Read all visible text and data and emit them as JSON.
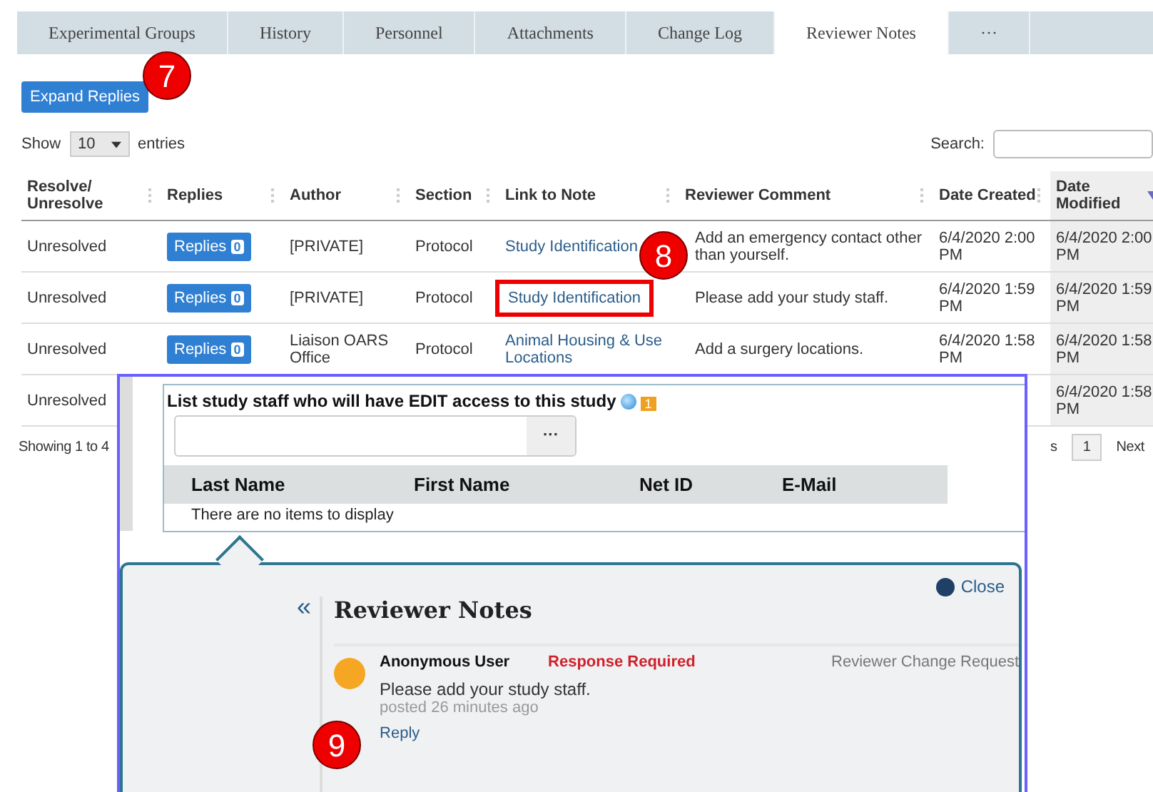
{
  "tabs": [
    {
      "label": "Experimental Groups",
      "selected": false
    },
    {
      "label": "History",
      "selected": false
    },
    {
      "label": "Personnel",
      "selected": false
    },
    {
      "label": "Attachments",
      "selected": false
    },
    {
      "label": "Change Log",
      "selected": false
    },
    {
      "label": "Reviewer Notes",
      "selected": true
    },
    {
      "label": "···",
      "selected": false
    }
  ],
  "expand_button": "Expand Replies",
  "length_menu": {
    "before": "Show",
    "value": "10",
    "after": "entries"
  },
  "search": {
    "label": "Search:"
  },
  "table": {
    "columns": [
      {
        "label": "Resolve/ Unresolve",
        "sorted": false
      },
      {
        "label": "Replies",
        "sorted": false
      },
      {
        "label": "Author",
        "sorted": false
      },
      {
        "label": "Section",
        "sorted": false
      },
      {
        "label": "Link to Note",
        "sorted": false
      },
      {
        "label": "Reviewer Comment",
        "sorted": false
      },
      {
        "label": "Date Created",
        "sorted": false
      },
      {
        "label": "Date Modified",
        "sorted": true
      }
    ],
    "rows": [
      {
        "resolve": "Unresolved",
        "replies": "Replies",
        "count": "0",
        "author": "[PRIVATE]",
        "section": "Protocol",
        "link": "Study Identification",
        "highlighted": false,
        "comment": "Add an emergency contact other than yourself.",
        "created": "6/4/2020 2:00 PM",
        "modified": "6/4/2020 2:00 PM"
      },
      {
        "resolve": "Unresolved",
        "replies": "Replies",
        "count": "0",
        "author": "[PRIVATE]",
        "section": "Protocol",
        "link": "Study Identification",
        "highlighted": true,
        "comment": "Please add your study staff.",
        "created": "6/4/2020 1:59 PM",
        "modified": "6/4/2020 1:59 PM"
      },
      {
        "resolve": "Unresolved",
        "replies": "Replies",
        "count": "0",
        "author": "Liaison OARS Office",
        "section": "Protocol",
        "link": "Animal Housing & Use Locations",
        "highlighted": false,
        "comment": "Add a surgery locations.",
        "created": "6/4/2020 1:58 PM",
        "modified": "6/4/2020 1:58 PM"
      },
      {
        "resolve": "Unresolved",
        "modified": "6/4/2020 1:58 PM"
      }
    ]
  },
  "footer": {
    "info": "Showing 1 to 4",
    "previous_partial": "s",
    "page": "1",
    "next": "Next"
  },
  "edit_panel": {
    "label": "List study staff who will have EDIT access to this study",
    "comment_count": "1",
    "lookup_button": "···",
    "columns": [
      "Last Name",
      "First Name",
      "Net ID",
      "E-Mail"
    ],
    "empty": "There are no items to display"
  },
  "notes_popover": {
    "close": "Close",
    "collapse": "«",
    "title": "Reviewer Notes",
    "notes": [
      {
        "author": "Anonymous User",
        "status": "Response Required",
        "type": "Reviewer Change Request",
        "text": "Please add your study staff.",
        "posted": "posted 26 minutes ago",
        "reply": "Reply"
      }
    ]
  },
  "callouts": [
    "7",
    "8",
    "9"
  ]
}
